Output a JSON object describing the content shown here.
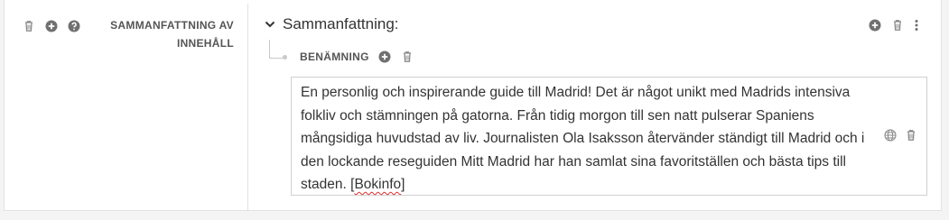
{
  "field": {
    "label": "SAMMANFATTNING AV INNEHÅLL",
    "icons": [
      "trash-icon",
      "plus-circle-icon",
      "help-circle-icon"
    ]
  },
  "section": {
    "title": "Sammanfattning:",
    "icons": [
      "chevron-down-icon",
      "plus-circle-icon",
      "trash-icon",
      "kebab-menu-icon"
    ]
  },
  "subfield": {
    "label": "BENÄMNING",
    "icons": [
      "plus-circle-icon",
      "trash-icon"
    ]
  },
  "textbox": {
    "text_before": "En personlig och inspirerande guide till Madrid! Det är något unikt med Madrids intensiva folkliv och stämningen på gatorna. Från tidig morgon till sen natt pulserar Spaniens mångsidiga huvudstad av liv. Journalisten Ola Isaksson återvänder ständigt till Madrid och i den lockande reseguiden Mitt Madrid har han samlat sina favoritställen och bästa tips till staden. [",
    "misspelled": "Bokinfo",
    "text_after": "]",
    "icons": [
      "globe-icon",
      "trash-icon"
    ]
  },
  "colors": {
    "icon": "#8a8a8a",
    "border": "#d0d0d0",
    "spellcheck": "#e03030"
  }
}
